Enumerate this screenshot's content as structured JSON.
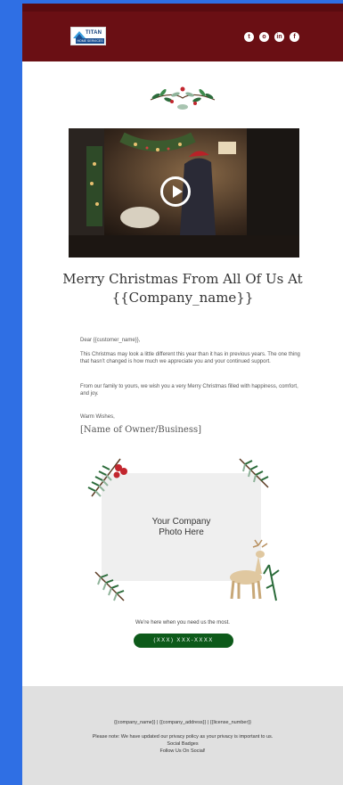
{
  "header": {
    "logo_brand": "TITAN",
    "logo_sub": "HOME SERVICES",
    "social": [
      {
        "name": "twitter-icon",
        "glyph": "t"
      },
      {
        "name": "instagram-icon",
        "glyph": "o"
      },
      {
        "name": "linkedin-icon",
        "glyph": "in"
      },
      {
        "name": "facebook-icon",
        "glyph": "f"
      }
    ]
  },
  "headline": {
    "line1": "Merry Christmas From All Of Us At",
    "line2": "{{Company_name}}"
  },
  "letter": {
    "greeting": "Dear {{customer_name}},",
    "p1": "This Christmas may look a little different this year than it has in previous years. The one thing that hasn’t changed is how much we appreciate you and your continued support.",
    "p2": "From our family to yours, we wish you a very Merry Christmas filled with happiness, comfort, and joy.",
    "closing": "Warm Wishes,",
    "signature": "[Name of Owner/Business]"
  },
  "photo": {
    "line1": "Your Company",
    "line2": "Photo Here"
  },
  "cta": {
    "tagline": "We’re here when you need us the most.",
    "phone": "(XXX) XXX-XXXX"
  },
  "footer": {
    "address": "{{company_name}} | {{company_address}} | {{license_number}}",
    "policy": "Please note: We have updated our privacy policy as your privacy is important to us.",
    "badges": "Social Badges",
    "follow": "Follow Us On Social!"
  },
  "colors": {
    "header": "#6a0f14",
    "button": "#0d5a1a",
    "sidebar": "#2f6fe4"
  }
}
